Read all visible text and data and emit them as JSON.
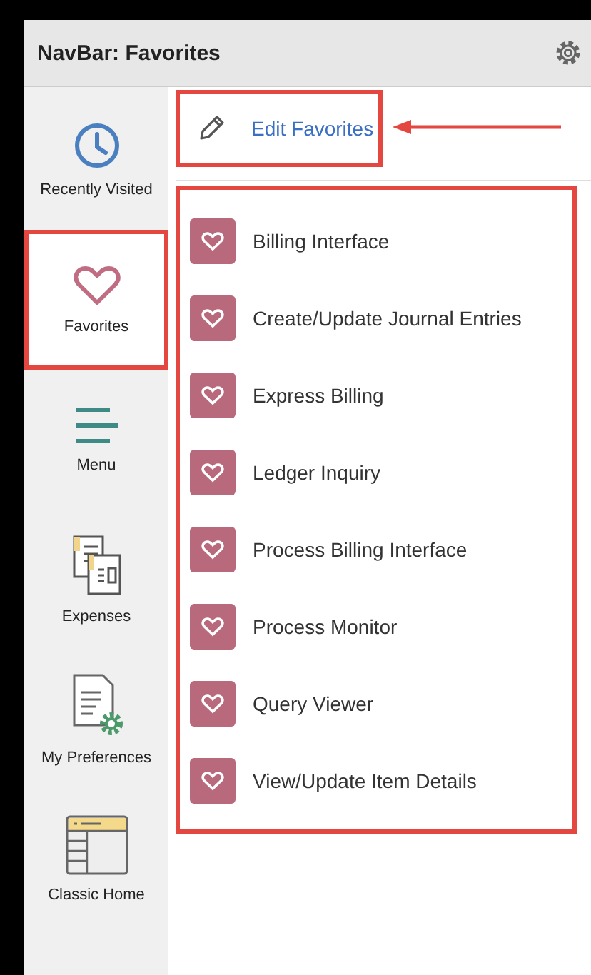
{
  "window": {
    "title": "NavBar: Favorites"
  },
  "sidebar": {
    "items": [
      {
        "kind": "clock",
        "label": "Recently Visited",
        "selected": false,
        "highlighted": false
      },
      {
        "kind": "heart",
        "label": "Favorites",
        "selected": true,
        "highlighted": true
      },
      {
        "kind": "menu",
        "label": "Menu",
        "selected": false,
        "highlighted": false
      },
      {
        "kind": "expenses",
        "label": "Expenses",
        "selected": false,
        "highlighted": false
      },
      {
        "kind": "preferences",
        "label": "My Preferences",
        "selected": false,
        "highlighted": false
      },
      {
        "kind": "classic-home",
        "label": "Classic Home",
        "selected": false,
        "highlighted": false
      }
    ]
  },
  "edit_favorites": {
    "label": "Edit Favorites",
    "highlighted": true,
    "pointed_at": true
  },
  "favorites": {
    "highlighted": true,
    "items": [
      {
        "label": "Billing Interface"
      },
      {
        "label": "Create/Update Journal Entries"
      },
      {
        "label": "Express Billing"
      },
      {
        "label": "Ledger Inquiry"
      },
      {
        "label": "Process Billing Interface"
      },
      {
        "label": "Process Monitor"
      },
      {
        "label": "Query Viewer"
      },
      {
        "label": "View/Update Item Details"
      }
    ]
  }
}
